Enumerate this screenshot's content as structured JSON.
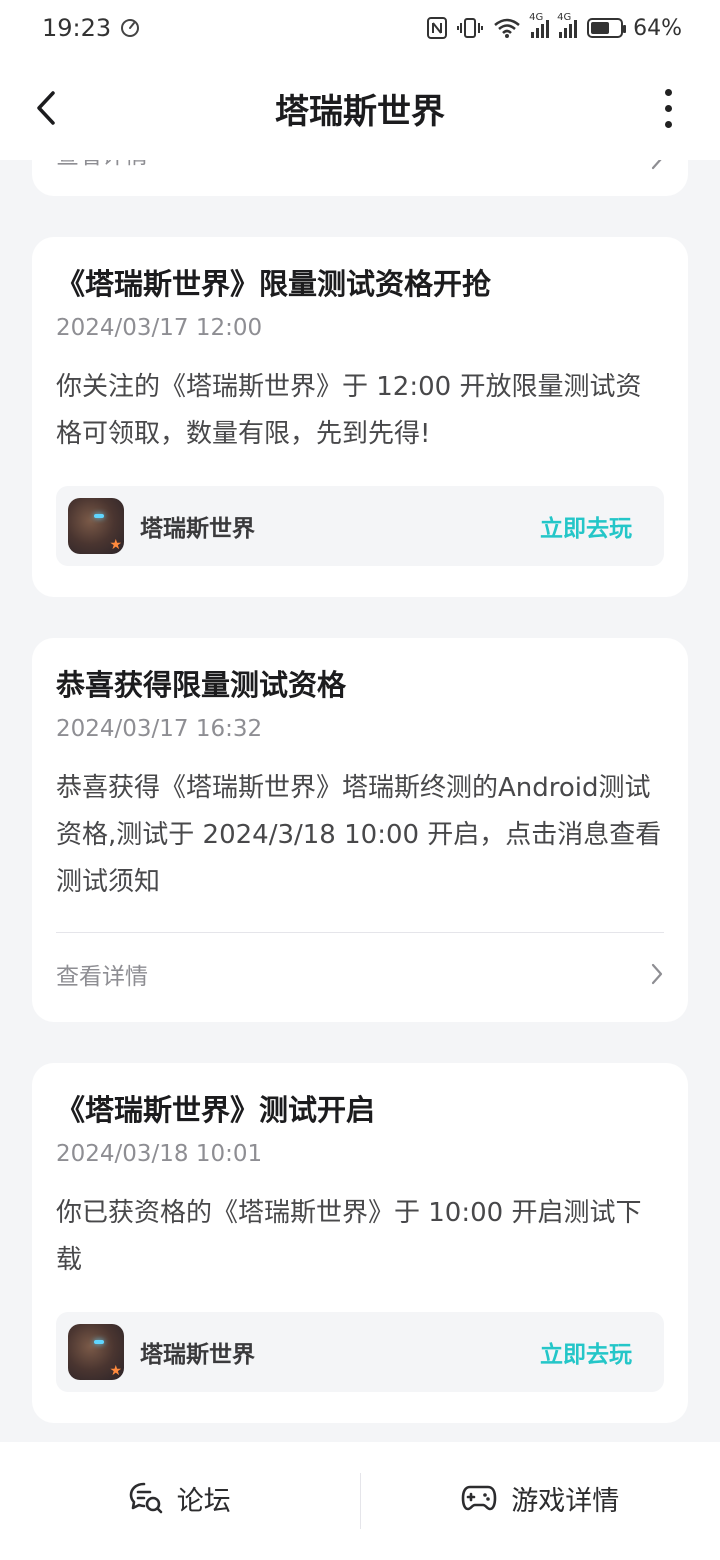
{
  "status_bar": {
    "time": "19:23",
    "battery_percent": "64%",
    "signal1_label": "4G",
    "signal2_label": "4G"
  },
  "header": {
    "title": "塔瑞斯世界"
  },
  "partial_card": {
    "detail_label": "查看详情"
  },
  "cards": [
    {
      "title": "《塔瑞斯世界》限量测试资格开抢",
      "date": "2024/03/17 12:00",
      "body": "你关注的《塔瑞斯世界》于 12:00 开放限量测试资格可领取，数量有限，先到先得!",
      "game_name": "塔瑞斯世界",
      "action_label": "立即去玩"
    },
    {
      "title": "恭喜获得限量测试资格",
      "date": "2024/03/17 16:32",
      "body": "恭喜获得《塔瑞斯世界》塔瑞斯终测的Android测试资格,测试于 2024/3/18 10:00 开启，点击消息查看测试须知",
      "detail_label": "查看详情"
    },
    {
      "title": "《塔瑞斯世界》测试开启",
      "date": "2024/03/18 10:01",
      "body": "你已获资格的《塔瑞斯世界》于 10:00 开启测试下载",
      "game_name": "塔瑞斯世界",
      "action_label": "立即去玩"
    }
  ],
  "bottom_bar": {
    "forum_label": "论坛",
    "game_detail_label": "游戏详情"
  },
  "colors": {
    "accent": "#24c6c8",
    "background": "#f4f5f7"
  }
}
